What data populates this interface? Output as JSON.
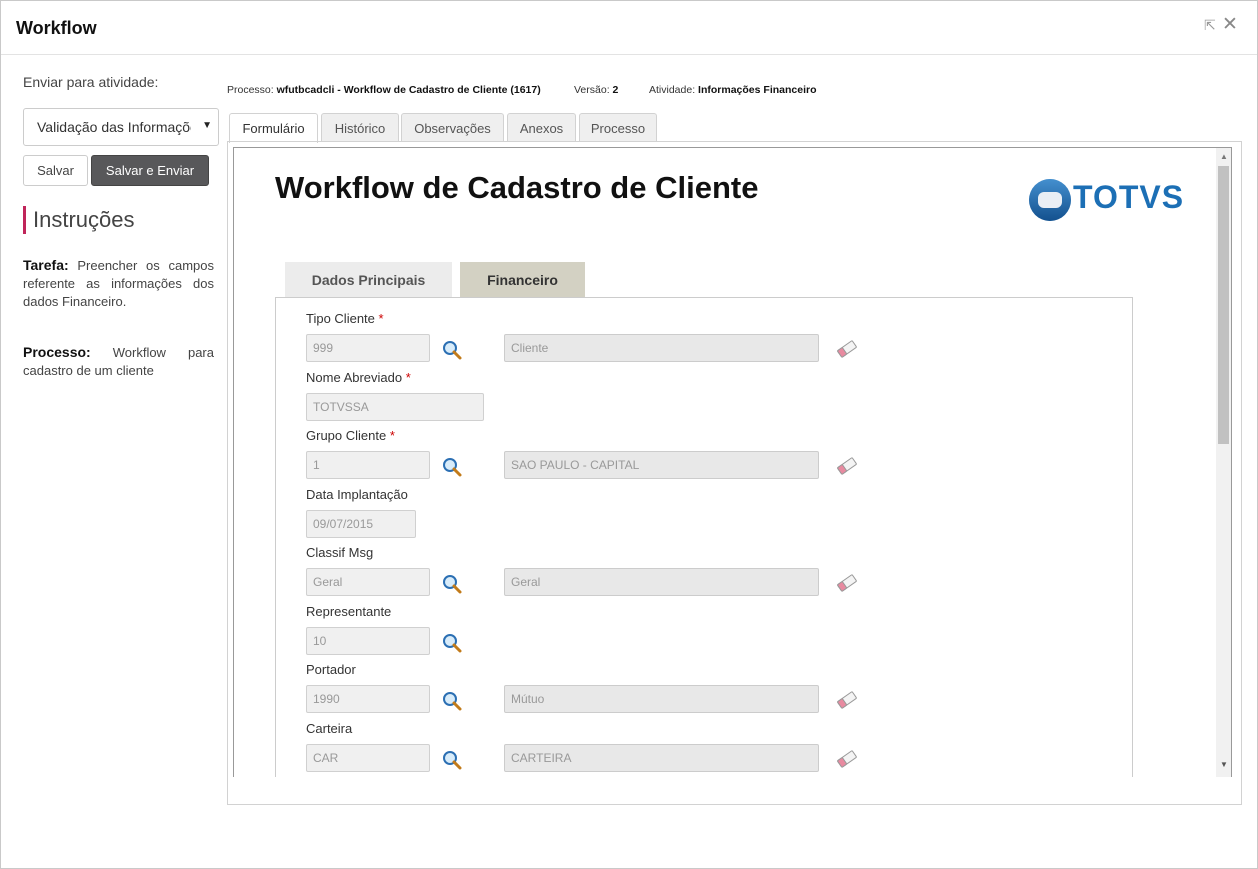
{
  "window": {
    "title": "Workflow",
    "restore_glyph": "⇱",
    "close_glyph": "✕"
  },
  "sidebar": {
    "send_label": "Enviar para atividade:",
    "activity_value": "Validação das Informações",
    "save_label": "Salvar",
    "save_send_label": "Salvar e Enviar",
    "instructions_title": "Instruções",
    "task_label": "Tarefa:",
    "task_text": "Preencher os campos referente as informações dos dados Financeiro.",
    "process_label": "Processo:",
    "process_text": "Workflow para cadastro de um cliente"
  },
  "process_info": {
    "process_label": "Processo:",
    "process_value": "wfutbcadcli - Workflow de Cadastro de Cliente (1617)",
    "version_label": "Versão:",
    "version_value": "2",
    "activity_label": "Atividade:",
    "activity_value": "Informações Financeiro"
  },
  "tabs": [
    "Formulário",
    "Histórico",
    "Observações",
    "Anexos",
    "Processo"
  ],
  "form": {
    "title": "Workflow de Cadastro de Cliente",
    "logo_text": "TOTVS",
    "sub_tabs": [
      "Dados Principais",
      "Financeiro"
    ],
    "required_mark": "*",
    "fields": {
      "tipo_cliente": {
        "label": "Tipo Cliente",
        "code": "999",
        "desc": "Cliente"
      },
      "nome_abreviado": {
        "label": "Nome Abreviado",
        "code": "TOTVSSA"
      },
      "grupo_cliente": {
        "label": "Grupo Cliente",
        "code": "1",
        "desc": "SAO PAULO - CAPITAL"
      },
      "data_implantacao": {
        "label": "Data Implantação",
        "code": "09/07/2015"
      },
      "classif_msg": {
        "label": "Classif Msg",
        "code": "Geral",
        "desc": "Geral"
      },
      "representante": {
        "label": "Representante",
        "code": "10"
      },
      "portador": {
        "label": "Portador",
        "code": "1990",
        "desc": "Mútuo"
      },
      "carteira": {
        "label": "Carteira",
        "code": "CAR",
        "desc": "CARTEIRA"
      }
    }
  },
  "colors": {
    "accent": "#c0255a",
    "logo_blue": "#1c6fb5",
    "active_subtab": "#d3d1c3",
    "primary_button": "#58585a"
  }
}
